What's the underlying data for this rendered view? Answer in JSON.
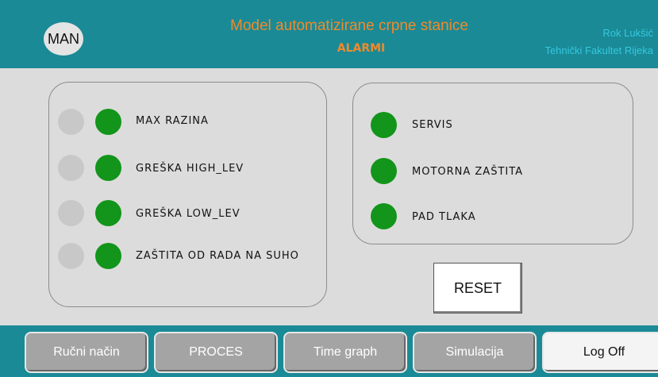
{
  "header": {
    "mode": "MAN",
    "title": "Model automatizirane crpne stanice",
    "subtitle": "ALARMI",
    "author_name": "Rok Lukšić",
    "author_affiliation": "Tehnički Fakultet Rijeka"
  },
  "alarms_left": [
    {
      "label": "MAX RAZINA",
      "status_color": "#12951a"
    },
    {
      "label": "GREŠKA HIGH_LEV",
      "status_color": "#12951a"
    },
    {
      "label": "GREŠKA LOW_LEV",
      "status_color": "#12951a"
    },
    {
      "label": "ZAŠTITA OD RADA NA SUHO",
      "status_color": "#12951a"
    }
  ],
  "alarms_right": [
    {
      "label": "SERVIS",
      "status_color": "#12951a"
    },
    {
      "label": "MOTORNA ZAŠTITA",
      "status_color": "#12951a"
    },
    {
      "label": "PAD TLAKA",
      "status_color": "#12951a"
    }
  ],
  "reset_label": "RESET",
  "nav": [
    {
      "label": "Ručni način"
    },
    {
      "label": "PROCES"
    },
    {
      "label": "Time graph"
    },
    {
      "label": "Simulacija"
    },
    {
      "label": "Log Off"
    }
  ],
  "colors": {
    "header_bg": "#1a8a96",
    "title": "#f08a2b",
    "author": "#35c8e0",
    "ok_indicator": "#12951a"
  }
}
